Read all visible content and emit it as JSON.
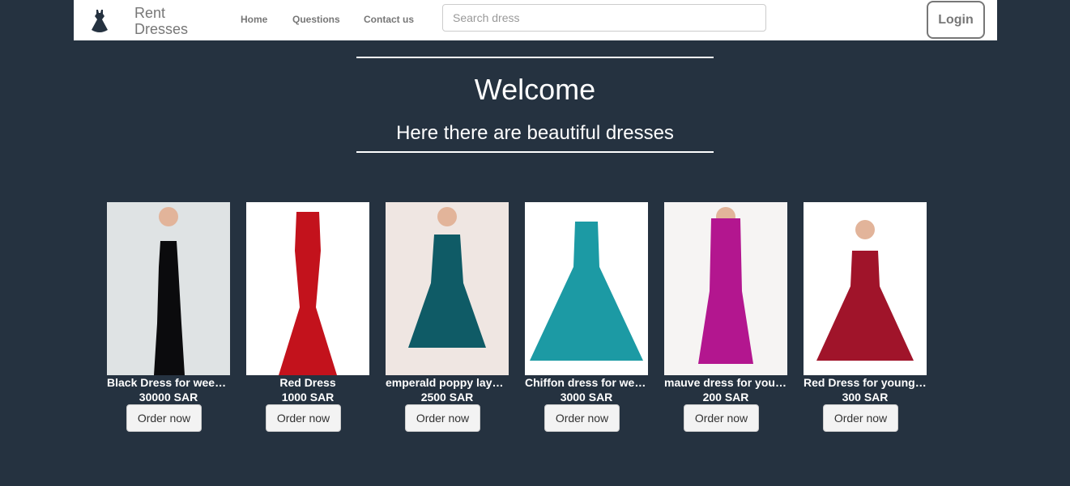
{
  "navbar": {
    "logo_icon": "dress-icon",
    "brand": "Rent Dresses",
    "links": [
      "Home",
      "Questions",
      "Contact us"
    ],
    "search_placeholder": "Search dress",
    "search_value": "",
    "login_label": "Login"
  },
  "hero": {
    "title": "Welcome",
    "subtitle": "Here there are beautiful dresses"
  },
  "colors": {
    "background": "#253240",
    "navbar": "#ffffff",
    "nav_text": "#777777",
    "button_bg": "#f3f3f3"
  },
  "products": [
    {
      "name": "Black Dress for weekend",
      "price": "30000 SAR",
      "button": "Order now",
      "dress_color": "#0b0b0d",
      "photo_bg": "#dfe3e4"
    },
    {
      "name": "Red Dress",
      "price": "1000 SAR",
      "button": "Order now",
      "dress_color": "#c3121c",
      "photo_bg": "#ffffff"
    },
    {
      "name": "emperald poppy layered dress",
      "price": "2500 SAR",
      "button": "Order now",
      "dress_color": "#0f5b66",
      "photo_bg": "#efe6e2"
    },
    {
      "name": "Chiffon dress for wedding",
      "price": "3000 SAR",
      "button": "Order now",
      "dress_color": "#1c9aa4",
      "photo_bg": "#ffffff"
    },
    {
      "name": "mauve dress for young girls",
      "price": "200 SAR",
      "button": "Order now",
      "dress_color": "#b3168f",
      "photo_bg": "#f6f4f3"
    },
    {
      "name": "Red Dress for young girls",
      "price": "300 SAR",
      "button": "Order now",
      "dress_color": "#a0142a",
      "photo_bg": "#ffffff"
    }
  ]
}
